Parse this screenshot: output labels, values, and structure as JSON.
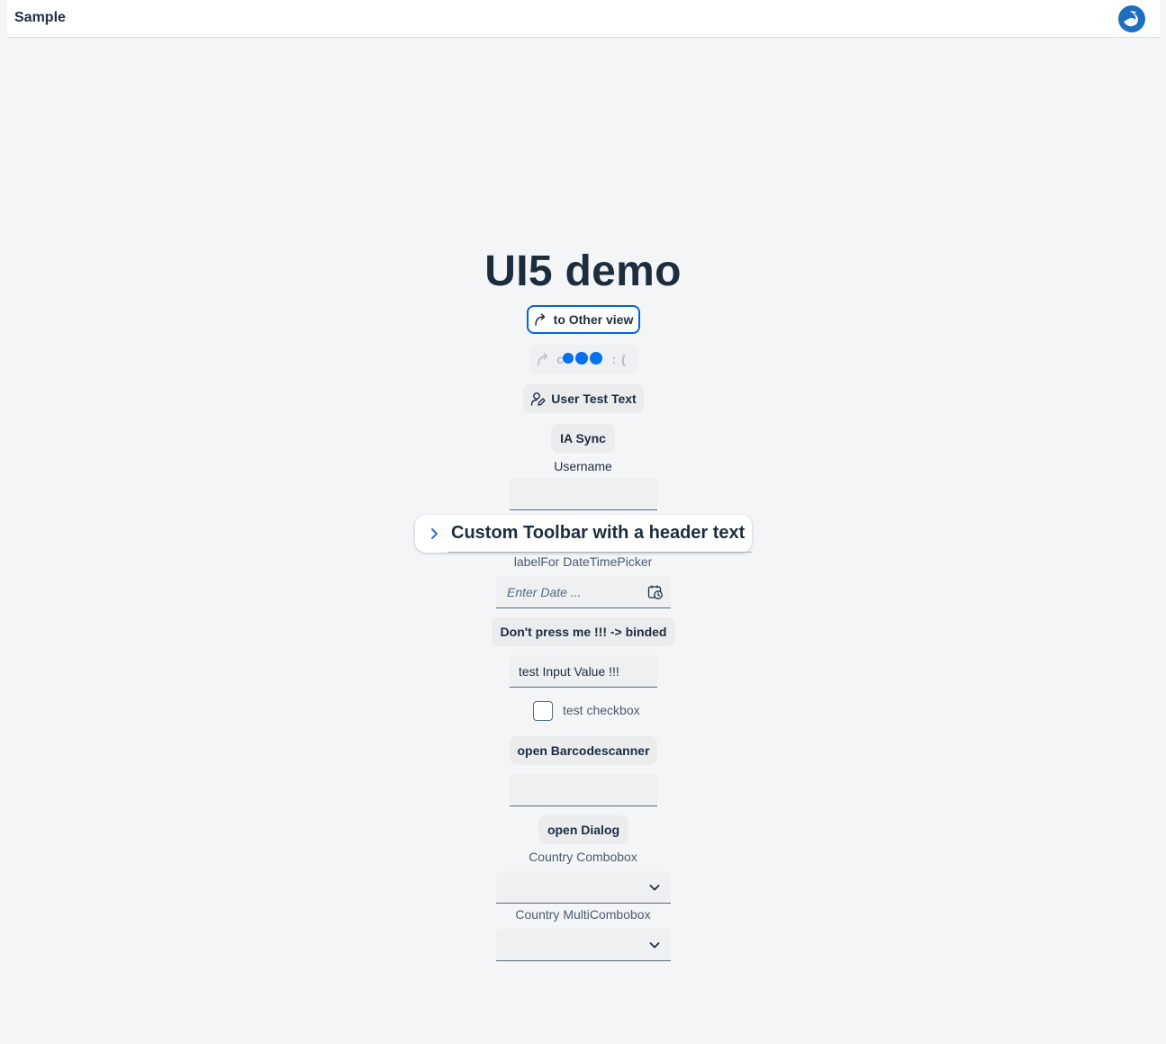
{
  "header": {
    "title": "Sample",
    "logo_icon": "sap-logo-icon"
  },
  "main": {
    "title": "UI5 demo",
    "buttons": {
      "to_other_view": "to Other view",
      "busy_button": "c ck :(",
      "user_test_text": "User Test Text",
      "ia_sync": "IA Sync",
      "dont_press": "Don't press me !!! -> binded",
      "open_barcodescanner": "open Barcodescanner",
      "open_dialog": "open Dialog"
    },
    "username_label": "Username",
    "username_value": "",
    "toolbar_header_text": "Custom Toolbar with a header text",
    "datetime_label": "labelFor DateTimePicker",
    "datetime_placeholder": "Enter Date ...",
    "test_input_value": "test Input Value !!!",
    "checkbox_label": "test checkbox",
    "checkbox_checked": false,
    "barcode_input_value": "",
    "country_combobox_label": "Country Combobox",
    "country_multicombobox_label": "Country MultiCombobox"
  },
  "colors": {
    "background": "#f4f5f7",
    "brand": "#0064d9",
    "busy_indicator": "#0070f2",
    "text": "#1d2d3e"
  }
}
